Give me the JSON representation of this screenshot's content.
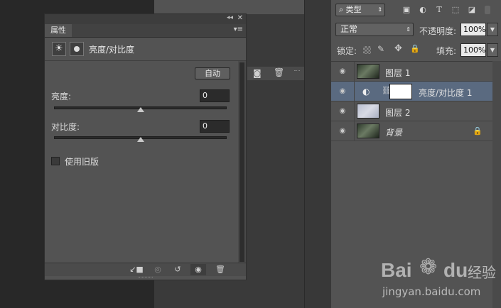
{
  "properties_panel": {
    "tab_label": "属性",
    "menu_glyph": "▾≡",
    "collapse_glyph": "◂◂",
    "close_glyph": "✕",
    "header_title": "亮度/对比度",
    "auto_label": "自动",
    "brightness": {
      "label": "亮度:",
      "value": "0",
      "slider_fraction": 0.5
    },
    "contrast": {
      "label": "对比度:",
      "value": "0",
      "slider_fraction": 0.5
    },
    "use_legacy_label": "使用旧版",
    "use_legacy_checked": false
  },
  "layers_panel": {
    "filter_label": "类型",
    "blend_mode": "正常",
    "opacity_label": "不透明度:",
    "opacity_value": "100%",
    "lock_label": "锁定:",
    "fill_label": "填充:",
    "fill_value": "100%",
    "layers": [
      {
        "name": "图层 1",
        "thumb": "photo",
        "selected": false
      },
      {
        "name": "亮度/对比度 1",
        "thumb": "adjustment",
        "selected": true
      },
      {
        "name": "图层 2",
        "thumb": "texture",
        "selected": false
      },
      {
        "name": "背景",
        "thumb": "photo",
        "selected": false,
        "locked": true
      }
    ]
  },
  "icons": {
    "brightness": "brightness-icon",
    "mask": "mask-icon",
    "eye": "eye-icon",
    "camera": "camera-icon",
    "trash": "trash-icon",
    "lock": "lock-icon",
    "link": "link-icon"
  },
  "colors": {
    "panel_bg": "#535353",
    "selected_row": "#5a6a80",
    "canvas_bg": "#282828"
  },
  "watermark": {
    "brand_a": "Bai",
    "brand_b": "du",
    "brand_cn": "经验",
    "url": "jingyan.baidu.com"
  }
}
